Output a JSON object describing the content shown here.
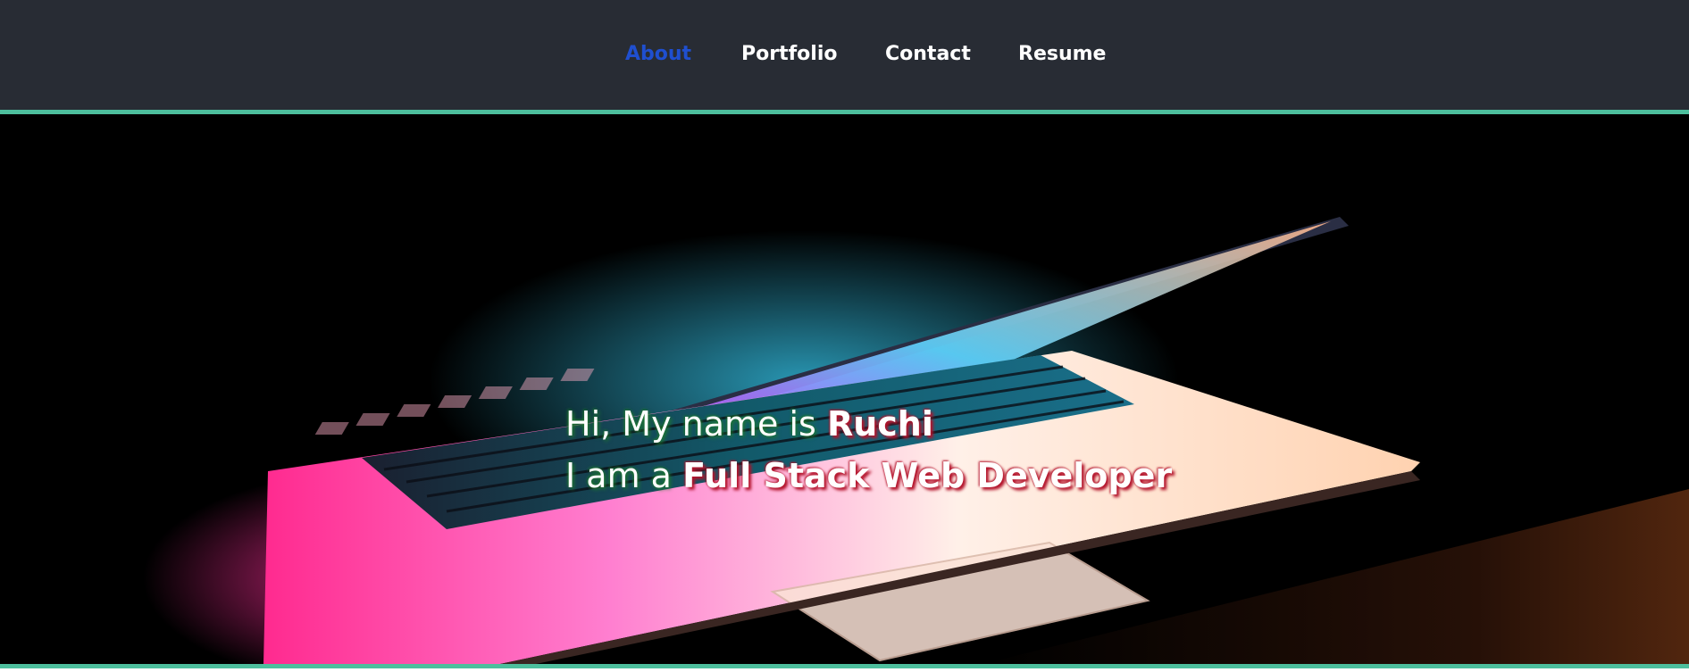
{
  "nav": {
    "items": [
      {
        "label": "About",
        "active": true
      },
      {
        "label": "Portfolio",
        "active": false
      },
      {
        "label": "Contact",
        "active": false
      },
      {
        "label": "Resume",
        "active": false
      }
    ]
  },
  "hero": {
    "line1_prefix": "Hi, My name is",
    "line1_name": "Ruchi",
    "line2_prefix": "I am a",
    "line2_role": "Full Stack Web Developer"
  },
  "colors": {
    "navbar_bg": "#282c34",
    "accent_border": "#4dbf9d",
    "active_link": "#1f4fd0",
    "link": "#ffffff",
    "hero_bg": "#000000"
  }
}
